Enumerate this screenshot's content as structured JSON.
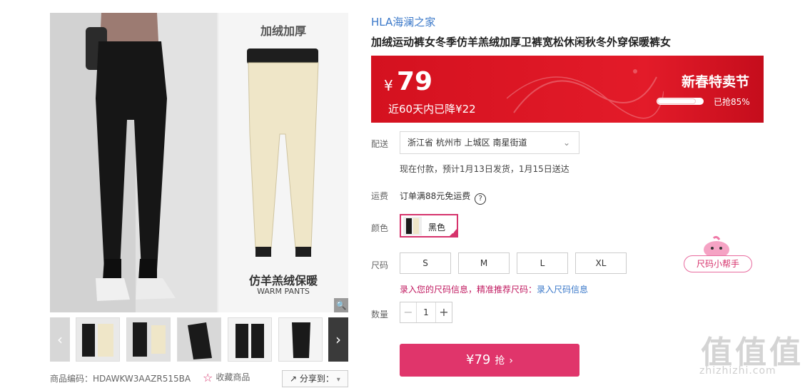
{
  "gallery": {
    "promo_top": "加绒加厚",
    "promo_bottom": "仿羊羔绒保暖",
    "promo_sub": "WARM PANTS",
    "zoom_icon": "magnifier-icon",
    "prev_icon": "chevron-left-icon",
    "next_icon": "chevron-right-icon",
    "sku_line": "商品编码：HDAWKW3AAZR515BA",
    "favorite_label": "收藏商品",
    "share_label": "分享到："
  },
  "product": {
    "brand": "HLA海澜之家",
    "title": "加绒运动裤女冬季仿羊羔绒加厚卫裤宽松休闲秋冬外穿保暖裤女"
  },
  "price_band": {
    "currency": "¥",
    "price": "79",
    "drop_text": "近60天内已降¥22",
    "festival": "新春特卖节",
    "sold_text": "已抢85%",
    "sold_fraction": 0.85,
    "accent": "#e31b29"
  },
  "delivery": {
    "label": "配送",
    "address": "浙江省 杭州市 上城区 南星街道",
    "eta": "现在付款，预计1月13日发货，1月15日送达"
  },
  "shipping_fee": {
    "label": "运费",
    "text": "订单满88元免运费",
    "help": "?"
  },
  "color": {
    "label": "颜色",
    "selected": "黑色"
  },
  "size": {
    "label": "尺码",
    "options": [
      "S",
      "M",
      "L",
      "XL"
    ],
    "tip_prefix": "录入您的尺码信息，精准推荐尺码：",
    "tip_link": "录入尺码信息",
    "helper": "尺码小帮手"
  },
  "quantity": {
    "label": "数量",
    "value": "1",
    "minus": "−",
    "plus": "+"
  },
  "buy": {
    "price": "¥79",
    "action": "抢",
    "accent": "#e0356b"
  },
  "watermark": {
    "big": "值值值",
    "url": "zhizhizhi.com"
  }
}
